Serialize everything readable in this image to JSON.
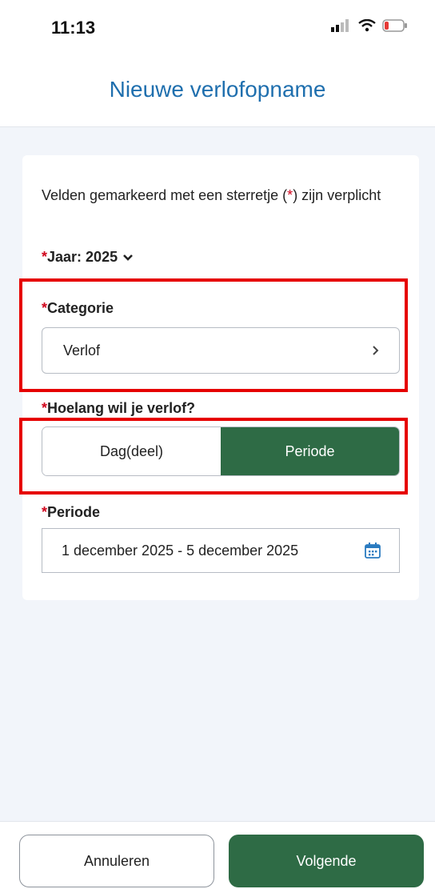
{
  "status_bar": {
    "time": "11:13"
  },
  "header": {
    "title": "Nieuwe verlofopname"
  },
  "form": {
    "intro_text_before": "Velden gemarkeerd met een sterretje (",
    "intro_asterisk": "*",
    "intro_text_after": ") zijn verplicht",
    "required_marker": "*",
    "year_label": "Jaar: 2025",
    "category": {
      "label": "Categorie",
      "value": "Verlof"
    },
    "duration": {
      "label": "Hoelang wil je verlof?",
      "options": [
        "Dag(deel)",
        "Periode"
      ],
      "selected": "Periode"
    },
    "period": {
      "label": "Periode",
      "value": "1 december 2025 - 5 december 2025"
    }
  },
  "footer": {
    "cancel_label": "Annuleren",
    "next_label": "Volgende"
  },
  "colors": {
    "title": "#1f6fae",
    "accent_green": "#2e6b45",
    "required_red": "#d0021b",
    "highlight_red": "#e60000"
  },
  "icons": {
    "status": [
      "signal-icon",
      "wifi-icon",
      "battery-icon"
    ],
    "year_dropdown": "chevron-down-icon",
    "category": "chevron-right-icon",
    "period": "calendar-icon"
  }
}
